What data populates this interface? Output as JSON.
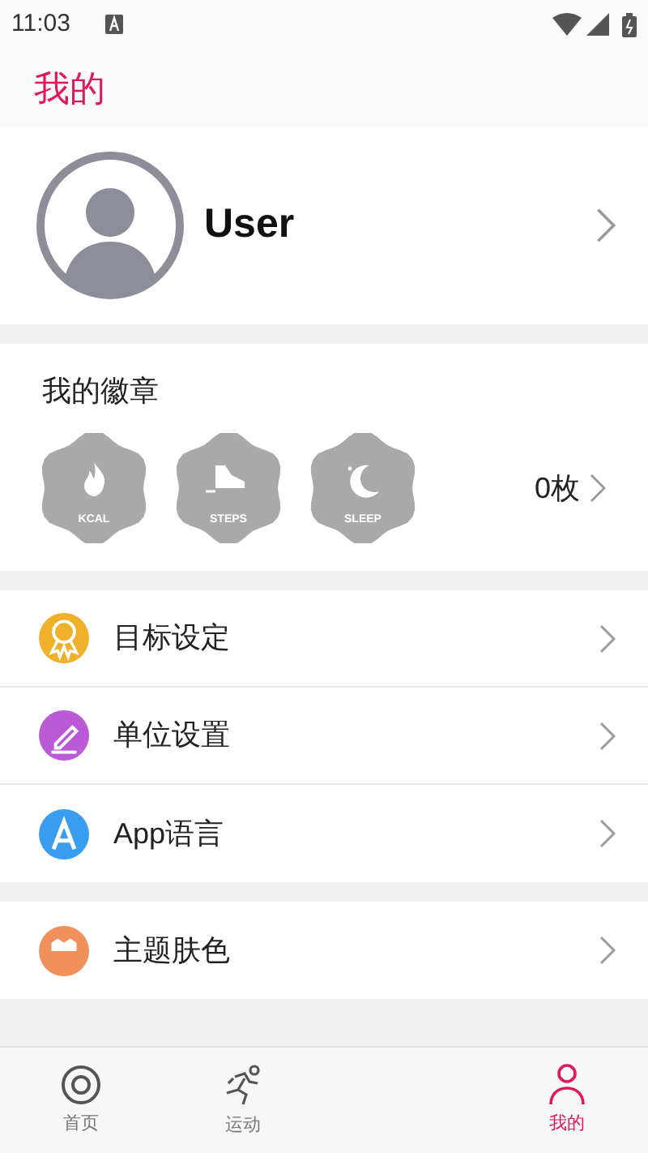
{
  "status_bar": {
    "time": "11:03"
  },
  "header": {
    "title": "我的"
  },
  "profile": {
    "name": "User"
  },
  "badges": {
    "title": "我的徽章",
    "count": "0枚",
    "items": [
      {
        "kind": "kcal",
        "label": "KCAL"
      },
      {
        "kind": "steps",
        "label": "STEPS"
      },
      {
        "kind": "sleep",
        "label": "SLEEP"
      }
    ]
  },
  "menu": [
    {
      "kind": "goal",
      "label": "目标设定",
      "color": "#f0b02a"
    },
    {
      "kind": "unit",
      "label": "单位设置",
      "color": "#bb5ad6"
    },
    {
      "kind": "language",
      "label": "App语言",
      "color": "#3a9ef0"
    }
  ],
  "menu_2": [
    {
      "kind": "theme",
      "label": "主题肤色",
      "color": "#f0905a"
    }
  ],
  "tabs": [
    {
      "kind": "home",
      "label": "首页",
      "selected": false
    },
    {
      "kind": "sport",
      "label": "运动",
      "selected": false
    },
    {
      "kind": "me",
      "label": "我的",
      "selected": true
    }
  ]
}
